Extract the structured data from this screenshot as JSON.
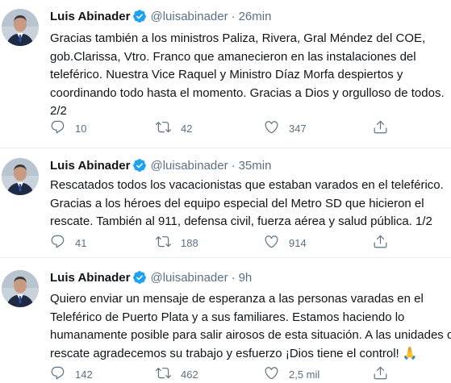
{
  "tweets": [
    {
      "name": "Luis Abinader",
      "handle": "@luisabinader",
      "separator": "·",
      "time": "26min",
      "lines": [
        "Gracias también a los ministros Paliza, Rivera, Gral Méndez del COE,",
        "gob.Clarissa, Vtro. Franco que amanecieron en las instalaciones del",
        "teleférico. Nuestra Vice Raquel y Ministro Díaz Morfa despiertos y",
        "coordinando todo hasta el momento. Gracias a Dios y orgulloso de todos.",
        "2/2"
      ],
      "replies": "10",
      "retweets": "42",
      "likes": "347"
    },
    {
      "name": "Luis Abinader",
      "handle": "@luisabinader",
      "separator": "·",
      "time": "35min",
      "lines": [
        "Rescatados todos los vacacionistas que estaban varados en el teleférico.",
        "Gracias a los héroes del equipo especial del Metro SD que hicieron el",
        "rescate. También al 911, defensa civil, fuerza aérea y salud pública. 1/2"
      ],
      "replies": "41",
      "retweets": "188",
      "likes": "914"
    },
    {
      "name": "Luis Abinader",
      "handle": "@luisabinader",
      "separator": "·",
      "time": "9h",
      "lines": [
        "Quiero enviar un mensaje de esperanza a las personas varadas en el",
        "Teleférico de Puerto Plata y a sus familiares. Estamos haciendo lo",
        "humanamente posible para salir airosos de esta situación. A las unidades de",
        "rescate agradecemos su trabajo y esfuerzo ¡Dios tiene el control! 🙏"
      ],
      "replies": "142",
      "retweets": "462",
      "likes": "2,5 mil"
    }
  ],
  "icons": {
    "reply": "reply-icon",
    "retweet": "retweet-icon",
    "like": "heart-icon",
    "share": "share-icon",
    "verified": "verified-badge-icon"
  },
  "colors": {
    "text": "#0f1419",
    "secondary": "#5b7083",
    "verified": "#1da1f2",
    "divider": "#e6ecf0"
  }
}
